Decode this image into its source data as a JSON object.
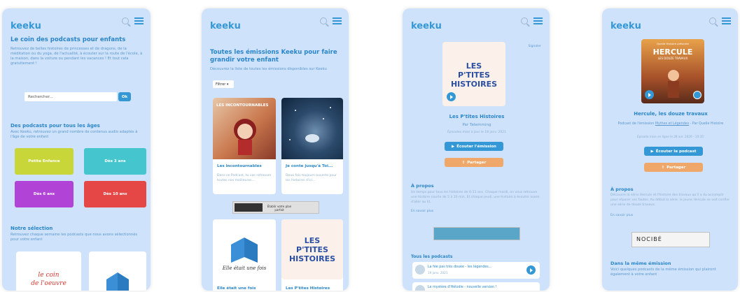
{
  "phone1": {
    "logo": "keeku",
    "title": "Le coin des podcasts pour enfants",
    "intro": "Retrouvez de belles histoires de princesses et de dragons, de la méditation ou du yoga, de l'actualité, à écouter sur la route de l'école, à la maison, dans la voiture ou pendant les vacances ! Et tout cela gratuitement !",
    "search_placeholder": "Rechercher...",
    "search_button": "Ok",
    "section_title": "Des podcasts pour tous les âges",
    "section_text": "Avec Keeku, retrouvez un grand nombre de contenus audio adaptés à l'âge de votre enfant",
    "age_buttons": [
      {
        "label": "Petite Enfance",
        "color": "#c9d63a"
      },
      {
        "label": "Dès 3 ans",
        "color": "#45c6cf"
      },
      {
        "label": "Dès 6 ans",
        "color": "#b144d6"
      },
      {
        "label": "Dès 10 ans",
        "color": "#e54646"
      }
    ],
    "selection_title": "Notre sélection",
    "selection_text": "Retrouvez chaque semaine les podcasts que nous avons sélectionnés pour votre enfant",
    "card1_text_1": "le coin",
    "card1_text_2": "de l'oeuvre"
  },
  "phone2": {
    "logo": "keeku",
    "title": "Toutes les émissions Keeku pour faire grandir votre enfant",
    "subtitle": "Découvrez la liste de toutes les émissions disponibles sur Keeku",
    "filter": "Filtrer",
    "cards": [
      {
        "title": "Les incontournables",
        "desc": "Dans ce Podcast, tu vas retrouver toutes nos meilleures...",
        "cover_text": "LES INCONTOURNABLES"
      },
      {
        "title": "Je conte jusqu'à Toi...",
        "desc": "Deux fois toujours ouverte pour les histoires d'ici...",
        "cover_text": ""
      },
      {
        "title": "Elle était une fois",
        "desc": "",
        "cover_text": "Elle était une fois"
      },
      {
        "title": "Les P'tites Histoires",
        "desc": "",
        "cover_text": "LES P'TITES HISTOIRES"
      }
    ],
    "ad_text": "Établir votre plan parfait"
  },
  "phone3": {
    "logo": "keeku",
    "corner_link": "Signaler",
    "cover_text": "LES P'TITES HISTOIRES",
    "show_title": "Les P'tites Histoires",
    "author": "Par Tatemming",
    "updated": "Épisodes mise à jour le 18 janv. 2021",
    "listen_button": "Écouter l'émission",
    "share_button": "Partager",
    "about_title": "À propos",
    "about_text": "Un temps pour tous les histoires de 6-11 ans. Chaque mardi, on vous retrouve une histoire courte de 5 à 10 min. Et chaque jeudi, une histoire à écouter avant d'aller au lit.",
    "more": "En savoir plus",
    "all_podcasts": "Tous les podcasts",
    "episodes": [
      {
        "title": "La fée pas très douée - les légendes...",
        "date": "19 janv. 2021"
      },
      {
        "title": "Le mystère d'Hélodie - nouvelle version !",
        "date": ""
      }
    ]
  },
  "phone4": {
    "logo": "keeku",
    "cover_title": "HERCULE",
    "cover_sub": "LES DOUZE TRAVAUX",
    "cover_top": "Quelle Histoire présente",
    "show_title": "Hercule, les douze travaux",
    "meta_prefix": "Podcast de l'émission ",
    "meta_link": "Mythes et Légendes",
    "meta_suffix": " - Par Quelle Histoire",
    "duration": "Épisode mise en ligne le 28 avr. 2020 - 10:35'",
    "listen_button": "Écouter le podcast",
    "share_button": "Partager",
    "about_title": "À propos",
    "about_text": "Découvre la série Hercule et l'histoire des travaux qu'il a du accomplir pour réparer ses fautes. Au début la série, le jeune Hercule se voit confier une série de douze travaux.",
    "more": "En savoir plus",
    "ad_brand": "NOCIBÉ",
    "same_title": "Dans la même émission",
    "same_text": "Voici quelques podcasts de la même émission qui plairont également à votre enfant"
  }
}
